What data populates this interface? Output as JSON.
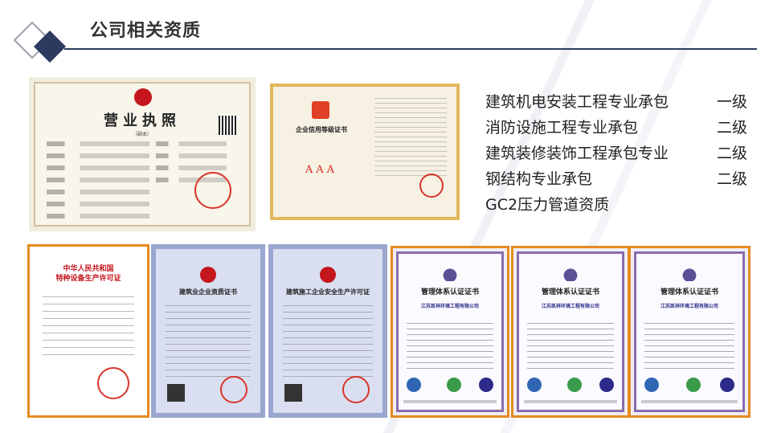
{
  "header": {
    "title": "公司相关资质"
  },
  "qualifications": [
    {
      "name": "建筑机电安装工程专业承包",
      "level": "一级"
    },
    {
      "name": "消防设施工程专业承包",
      "level": "二级"
    },
    {
      "name": "建筑装修装饰工程承包专业",
      "level": "二级"
    },
    {
      "name": "钢结构专业承包",
      "level": "二级"
    },
    {
      "name": "GC2压力管道资质",
      "level": ""
    }
  ],
  "certificates": {
    "business_license": {
      "title": "营业执照",
      "subtitle": "（副本）"
    },
    "credit": {
      "title": "企业信用等级证书",
      "rating": "AAA"
    },
    "special_equipment": {
      "title_line1": "中华人民共和国",
      "title_line2": "特种设备生产许可证"
    },
    "enterprise_qualification": {
      "title": "建筑业企业资质证书"
    },
    "safety_permit": {
      "title": "建筑施工企业安全生产许可证"
    },
    "management": [
      {
        "title": "管理体系认证证书",
        "company": "江苏凯祥环境工程有限公司"
      },
      {
        "title": "管理体系认证证书",
        "company": "江苏凯祥环境工程有限公司"
      },
      {
        "title": "管理体系认证证书",
        "company": "江苏凯祥环境工程有限公司"
      }
    ]
  },
  "colors": {
    "accent_navy": "#2b3a5e",
    "frame_orange": "#e58a1f",
    "stamp_red": "#d9342b"
  }
}
